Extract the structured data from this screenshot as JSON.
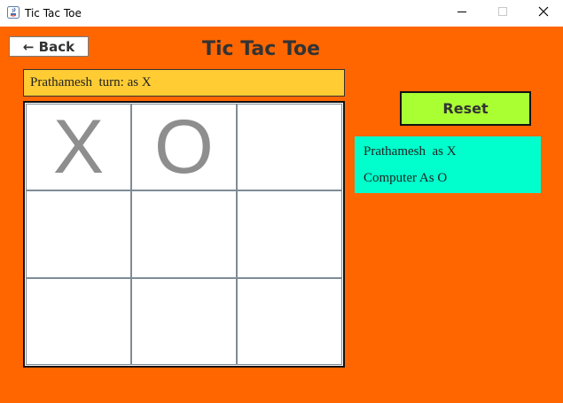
{
  "window": {
    "title": "Tic Tac Toe"
  },
  "toolbar": {
    "back_label": "← Back"
  },
  "page": {
    "title": "Tic Tac Toe"
  },
  "status": {
    "turn_text": "Prathamesh  turn: as X"
  },
  "board": {
    "cells": [
      "X",
      "O",
      "",
      "",
      "",
      "",
      "",
      "",
      ""
    ]
  },
  "controls": {
    "reset_label": "Reset"
  },
  "players": {
    "player1": "Prathamesh  as X",
    "player2": "Computer As O"
  },
  "colors": {
    "background": "#ff6600",
    "status_bg": "#ffcc33",
    "reset_bg": "#aaff33",
    "players_bg": "#00ffcc",
    "mark_color": "#8e8e8e"
  }
}
